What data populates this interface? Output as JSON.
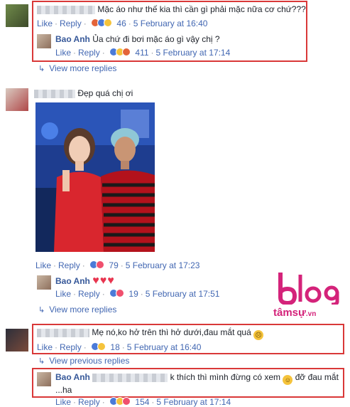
{
  "comments": [
    {
      "text": "Mặc áo như thế kia thì cần gì phải mặc nữa cơ chứ???",
      "like": "Like",
      "reply": "Reply",
      "count": "46",
      "date": "5 February at 16:40",
      "reply_item": {
        "author": "Bao Anh",
        "text": "Ủa chứ đi bơi mặc áo gì vậy chị ?",
        "like": "Like",
        "reply": "Reply",
        "count": "411",
        "date": "5 February at 17:14"
      },
      "view_more": "View more replies"
    },
    {
      "text": "Đẹp quá chị ơi",
      "like": "Like",
      "reply": "Reply",
      "count": "79",
      "date": "5 February at 17:23",
      "reply_item": {
        "author": "Bao Anh",
        "like": "Like",
        "reply": "Reply",
        "count": "19",
        "date": "5 February at 17:51"
      },
      "view_more": "View more replies"
    },
    {
      "text": "Mẹ nó,ko hở trên thì hở dưới,đau mắt quá",
      "like": "Like",
      "reply": "Reply",
      "count": "18",
      "date": "5 February at 16:40",
      "view_previous": "View previous replies",
      "reply_item": {
        "author": "Bao Anh",
        "text_after_blur": "k thích thì mình đừng có xem",
        "text_end": "đỡ đau mắt",
        "text_line2": "...ha",
        "like": "Like",
        "reply": "Reply",
        "count": "154",
        "date": "5 February at 17:14"
      }
    }
  ],
  "watermark": {
    "brand": "blog",
    "sub": "tâmsự",
    "domain": ".vn"
  },
  "colors": {
    "link": "#4267b2",
    "name": "#365899",
    "highlight": "#d93838",
    "meta": "#90949c"
  }
}
